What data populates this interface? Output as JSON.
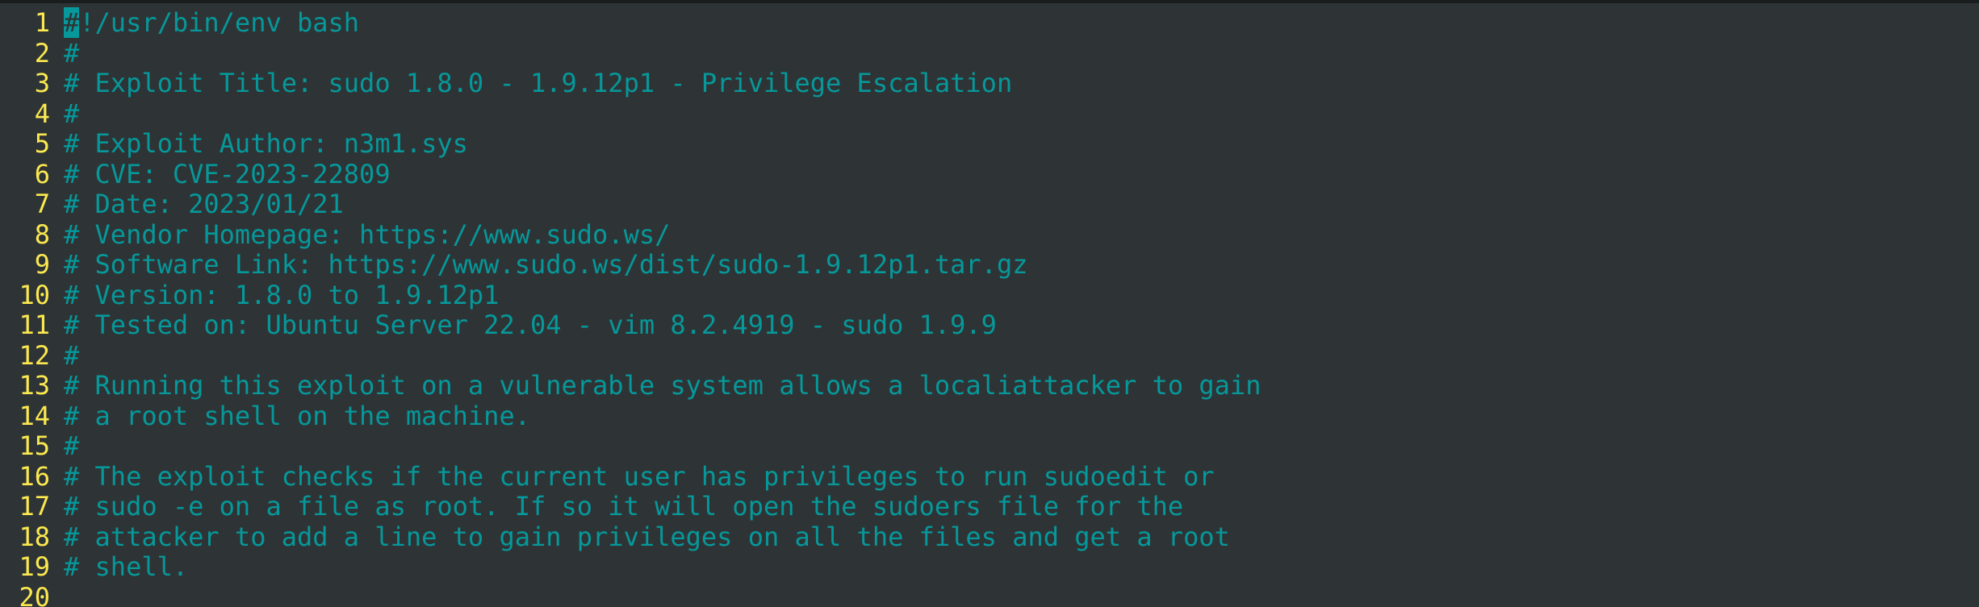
{
  "editor": {
    "colors": {
      "background": "#2e3436",
      "line_number": "#fce94f",
      "comment": "#06989a"
    },
    "cursor_char": "#",
    "lines": [
      {
        "num": "1",
        "text": "!/usr/bin/env bash"
      },
      {
        "num": "2",
        "text": "#"
      },
      {
        "num": "3",
        "text": "# Exploit Title: sudo 1.8.0 - 1.9.12p1 - Privilege Escalation"
      },
      {
        "num": "4",
        "text": "#"
      },
      {
        "num": "5",
        "text": "# Exploit Author: n3m1.sys"
      },
      {
        "num": "6",
        "text": "# CVE: CVE-2023-22809"
      },
      {
        "num": "7",
        "text": "# Date: 2023/01/21"
      },
      {
        "num": "8",
        "text": "# Vendor Homepage: https://www.sudo.ws/"
      },
      {
        "num": "9",
        "text": "# Software Link: https://www.sudo.ws/dist/sudo-1.9.12p1.tar.gz"
      },
      {
        "num": "10",
        "text": "# Version: 1.8.0 to 1.9.12p1"
      },
      {
        "num": "11",
        "text": "# Tested on: Ubuntu Server 22.04 - vim 8.2.4919 - sudo 1.9.9"
      },
      {
        "num": "12",
        "text": "#"
      },
      {
        "num": "13",
        "text": "# Running this exploit on a vulnerable system allows a localiattacker to gain"
      },
      {
        "num": "14",
        "text": "# a root shell on the machine."
      },
      {
        "num": "15",
        "text": "#"
      },
      {
        "num": "16",
        "text": "# The exploit checks if the current user has privileges to run sudoedit or"
      },
      {
        "num": "17",
        "text": "# sudo -e on a file as root. If so it will open the sudoers file for the"
      },
      {
        "num": "18",
        "text": "# attacker to add a line to gain privileges on all the files and get a root"
      },
      {
        "num": "19",
        "text": "# shell."
      },
      {
        "num": "20",
        "text": ""
      }
    ]
  }
}
